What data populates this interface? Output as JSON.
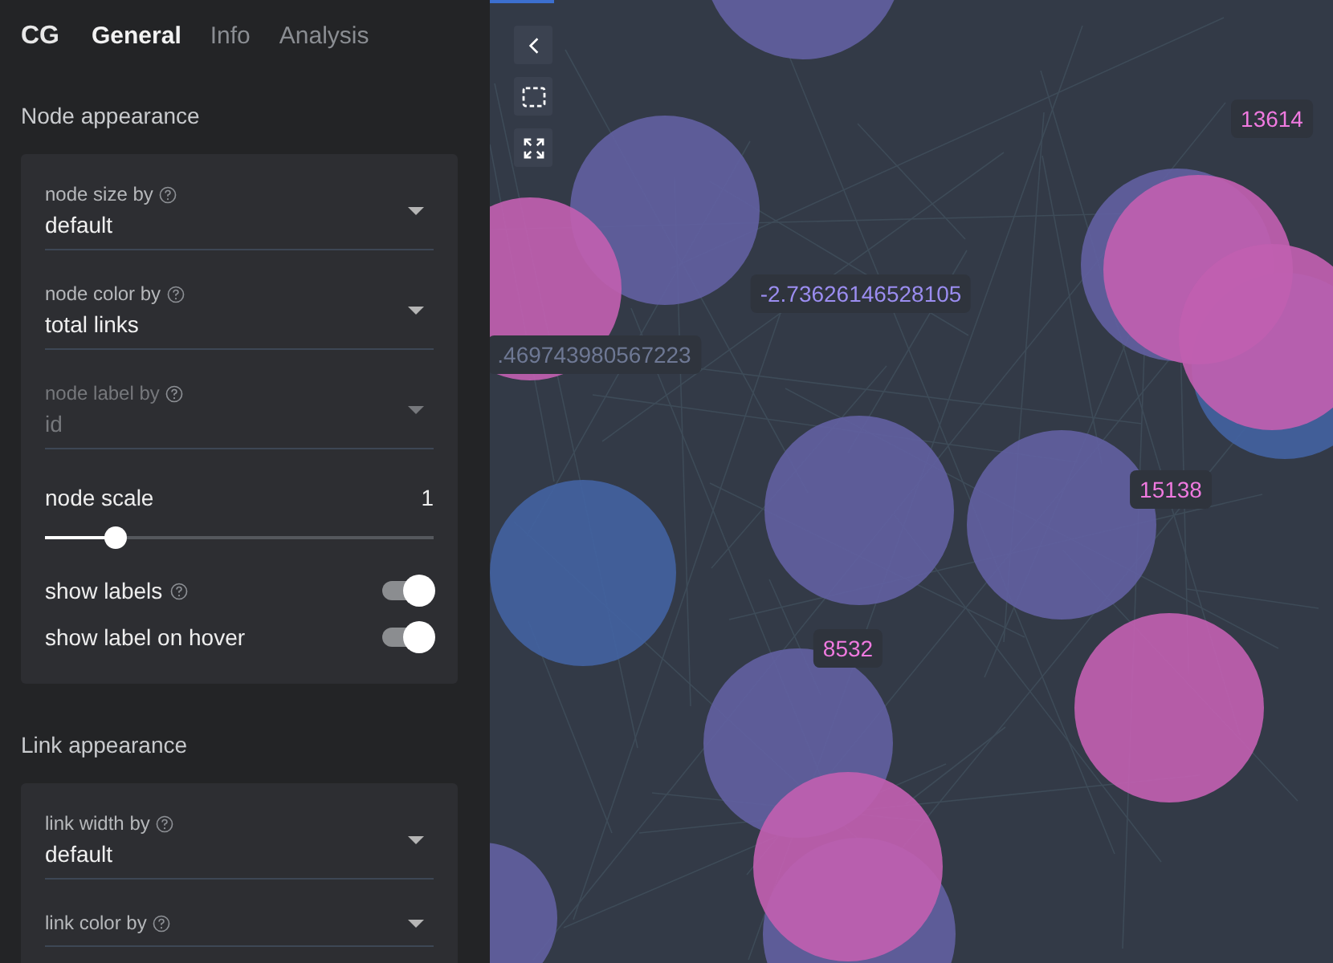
{
  "tabs": {
    "logo": "CG",
    "items": [
      {
        "label": "General",
        "selected": true
      },
      {
        "label": "Info",
        "selected": false
      },
      {
        "label": "Analysis",
        "selected": false
      }
    ]
  },
  "sections": [
    {
      "title": "Node appearance",
      "expanded": true,
      "controls": [
        {
          "kind": "select",
          "label": "node size by",
          "help": true,
          "value": "default",
          "disabled": false
        },
        {
          "kind": "select",
          "label": "node color by",
          "help": true,
          "value": "total links",
          "disabled": false
        },
        {
          "kind": "select",
          "label": "node label by",
          "help": true,
          "value": "id",
          "disabled": true
        },
        {
          "kind": "slider",
          "label": "node scale",
          "reading": "1",
          "level": 0.18
        },
        {
          "kind": "toggle",
          "label": "show labels",
          "help": true,
          "on": true
        },
        {
          "kind": "toggle",
          "label": "show label on hover",
          "on": true
        }
      ]
    },
    {
      "title": "Link appearance",
      "expanded": true,
      "controls": [
        {
          "kind": "select",
          "label": "link width by",
          "help": true,
          "value": "default",
          "disabled": false
        },
        {
          "kind": "select",
          "label": "link color by",
          "help": true,
          "disabled": false
        }
      ]
    }
  ],
  "canvas": {
    "labels": [
      {
        "text": "13614",
        "color": "#f07ae0"
      },
      {
        "text": "-2.73626146528105",
        "color": "#9b8df0"
      },
      {
        "text": ".469743980567223",
        "color": "#6e7894"
      },
      {
        "text": "15138",
        "color": "#f07ae0"
      },
      {
        "text": "8532",
        "color": "#f07ae0"
      }
    ]
  }
}
